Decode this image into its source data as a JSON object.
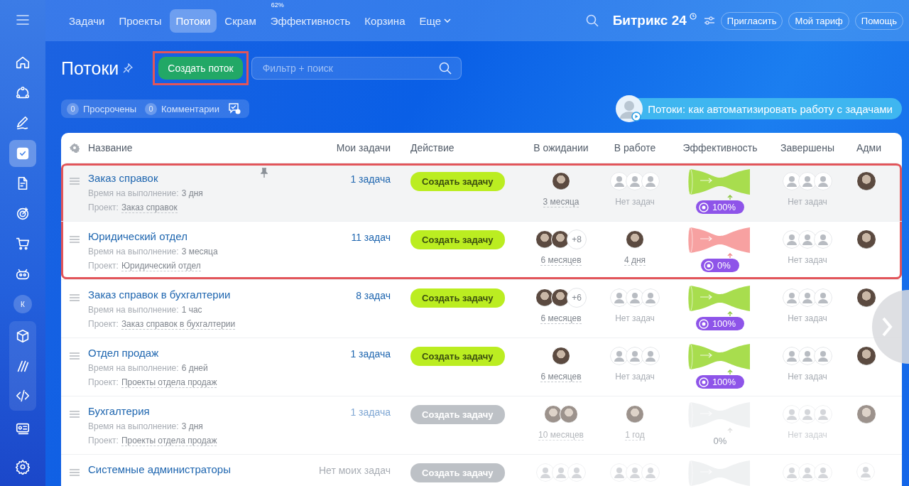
{
  "sidebar": {
    "items": [
      {
        "selected": false
      },
      {
        "selected": false
      },
      {
        "selected": false
      },
      {
        "selected": true
      },
      {
        "selected": false
      },
      {
        "selected": false
      },
      {
        "selected": false
      },
      {
        "selected": false
      },
      {
        "selected": false,
        "label": "К"
      },
      {
        "selected": false
      },
      {
        "selected": false
      },
      {
        "selected": false
      },
      {
        "selected": false
      },
      {
        "selected": false
      }
    ]
  },
  "top_nav": {
    "tabs": [
      {
        "label": "Задачи",
        "selected": false
      },
      {
        "label": "Проекты",
        "selected": false
      },
      {
        "label": "Потоки",
        "selected": true
      },
      {
        "label": "Скрам",
        "selected": false
      },
      {
        "label": "Эффективность",
        "selected": false,
        "counter": "62%"
      },
      {
        "label": "Корзина",
        "selected": false
      },
      {
        "label": "Еще",
        "selected": false,
        "dropdown": true
      }
    ],
    "logo": "Битрикс 24",
    "buttons": [
      "Пригласить",
      "Мой тариф",
      "Помощь"
    ]
  },
  "header": {
    "title": "Потоки",
    "create_button": "Создать поток",
    "create_button_annotated": true,
    "search": {
      "placeholder": "Фильтр + поиск"
    },
    "counters": [
      {
        "count": "0",
        "label": "Просрочены"
      },
      {
        "count": "0",
        "label": "Комментарии"
      }
    ],
    "video_banner": "Потоки: как автоматизировать работу с задачами"
  },
  "table": {
    "columns": [
      "Название",
      "Мои задачи",
      "Действие",
      "В ожидании",
      "В работе",
      "Эффективность",
      "Завершены",
      "Адми"
    ],
    "rows": [
      {
        "name": "Заказ справок",
        "deadline_label": "Время на выполнение:",
        "deadline": "3 дня",
        "project_label": "Проект:",
        "project": "Заказ справок",
        "my_tasks": "1 задача",
        "has_tasks": true,
        "active": true,
        "hovered": true,
        "pinned": true,
        "annotated": true,
        "action": "Создать задачу",
        "waiting": {
          "avatars": [
            {
              "kind": "photo"
            }
          ],
          "label": "3 месяца"
        },
        "in_work": {
          "avatars": [
            {
              "kind": "empty"
            },
            {
              "kind": "empty"
            },
            {
              "kind": "empty"
            }
          ],
          "label": "Нет задач"
        },
        "efficiency": {
          "kind": "good",
          "value": "100%"
        },
        "completed": {
          "avatars": [
            {
              "kind": "empty"
            },
            {
              "kind": "empty"
            },
            {
              "kind": "empty"
            }
          ],
          "label": "Нет задач"
        },
        "admin": {
          "kind": "photo"
        }
      },
      {
        "name": "Юридический отдел",
        "deadline_label": "Время на выполнение:",
        "deadline": "3 месяца",
        "project_label": "Проект:",
        "project": "Юридический отдел",
        "my_tasks": "11 задач",
        "has_tasks": true,
        "active": true,
        "hovered": false,
        "pinned": false,
        "annotated": true,
        "action": "Создать задачу",
        "waiting": {
          "avatars": [
            {
              "kind": "photo"
            },
            {
              "kind": "photo"
            }
          ],
          "more": "+8",
          "label": "6 месяцев"
        },
        "in_work": {
          "avatars": [
            {
              "kind": "photo"
            }
          ],
          "label": "4 дня"
        },
        "efficiency": {
          "kind": "bad",
          "value": "0%"
        },
        "completed": {
          "avatars": [
            {
              "kind": "empty"
            },
            {
              "kind": "empty"
            },
            {
              "kind": "empty"
            }
          ],
          "label": "Нет задач"
        },
        "admin": {
          "kind": "photo"
        }
      },
      {
        "name": "Заказ справок в бухгалтерии",
        "deadline_label": "Время на выполнение:",
        "deadline": "1 час",
        "project_label": "Проект:",
        "project": "Заказ справок в бухгалтерии",
        "my_tasks": "8 задач",
        "has_tasks": true,
        "active": true,
        "hovered": false,
        "pinned": false,
        "annotated": false,
        "action": "Создать задачу",
        "waiting": {
          "avatars": [
            {
              "kind": "photo"
            },
            {
              "kind": "photo"
            }
          ],
          "more": "+6",
          "label": "6 месяцев"
        },
        "in_work": {
          "avatars": [
            {
              "kind": "empty"
            },
            {
              "kind": "empty"
            },
            {
              "kind": "empty"
            }
          ],
          "label": "Нет задач"
        },
        "efficiency": {
          "kind": "good",
          "value": "100%"
        },
        "completed": {
          "avatars": [
            {
              "kind": "empty"
            },
            {
              "kind": "empty"
            },
            {
              "kind": "empty"
            }
          ],
          "label": "Нет задач"
        },
        "admin": {
          "kind": "photo"
        }
      },
      {
        "name": "Отдел продаж",
        "deadline_label": "Время на выполнение:",
        "deadline": "6 дней",
        "project_label": "Проект:",
        "project": "Проекты отдела продаж",
        "my_tasks": "1 задача",
        "has_tasks": true,
        "active": true,
        "hovered": false,
        "pinned": false,
        "annotated": false,
        "action": "Создать задачу",
        "waiting": {
          "avatars": [
            {
              "kind": "photo"
            }
          ],
          "label": "6 месяцев"
        },
        "in_work": {
          "avatars": [
            {
              "kind": "empty"
            },
            {
              "kind": "empty"
            },
            {
              "kind": "empty"
            }
          ],
          "label": "Нет задач"
        },
        "efficiency": {
          "kind": "good",
          "value": "100%"
        },
        "completed": {
          "avatars": [
            {
              "kind": "empty"
            },
            {
              "kind": "empty"
            },
            {
              "kind": "empty"
            }
          ],
          "label": "Нет задач"
        },
        "admin": {
          "kind": "photo"
        }
      },
      {
        "name": "Бухгалтерия",
        "deadline_label": "Время на выполнение:",
        "deadline": "3 дня",
        "project_label": "Проект:",
        "project": "Проекты отдела продаж",
        "my_tasks": "1 задача",
        "has_tasks": true,
        "active": false,
        "hovered": false,
        "pinned": false,
        "annotated": false,
        "action": "Создать задачу",
        "waiting": {
          "avatars": [
            {
              "kind": "photo"
            },
            {
              "kind": "photo"
            }
          ],
          "label": "10 месяцев"
        },
        "in_work": {
          "avatars": [
            {
              "kind": "photo"
            }
          ],
          "label": "1 год"
        },
        "efficiency": {
          "kind": "none",
          "value": "0%"
        },
        "completed": {
          "avatars": [
            {
              "kind": "empty"
            },
            {
              "kind": "empty"
            },
            {
              "kind": "empty"
            }
          ],
          "label": "Нет задач"
        },
        "admin": {
          "kind": "photo"
        }
      },
      {
        "name": "Системные администраторы",
        "my_tasks": "Нет моих задач",
        "has_tasks": false,
        "active": false,
        "hovered": false,
        "pinned": false,
        "annotated": false,
        "action": "Создать задачу",
        "waiting": {
          "avatars": [
            {
              "kind": "empty"
            },
            {
              "kind": "empty"
            },
            {
              "kind": "empty"
            }
          ]
        },
        "in_work": {
          "avatars": [
            {
              "kind": "empty"
            },
            {
              "kind": "empty"
            },
            {
              "kind": "empty"
            }
          ]
        },
        "efficiency": {
          "kind": "none"
        },
        "completed": {
          "avatars": [
            {
              "kind": "empty"
            },
            {
              "kind": "empty"
            },
            {
              "kind": "empty"
            }
          ]
        },
        "admin": {
          "kind": "empty"
        }
      }
    ]
  }
}
